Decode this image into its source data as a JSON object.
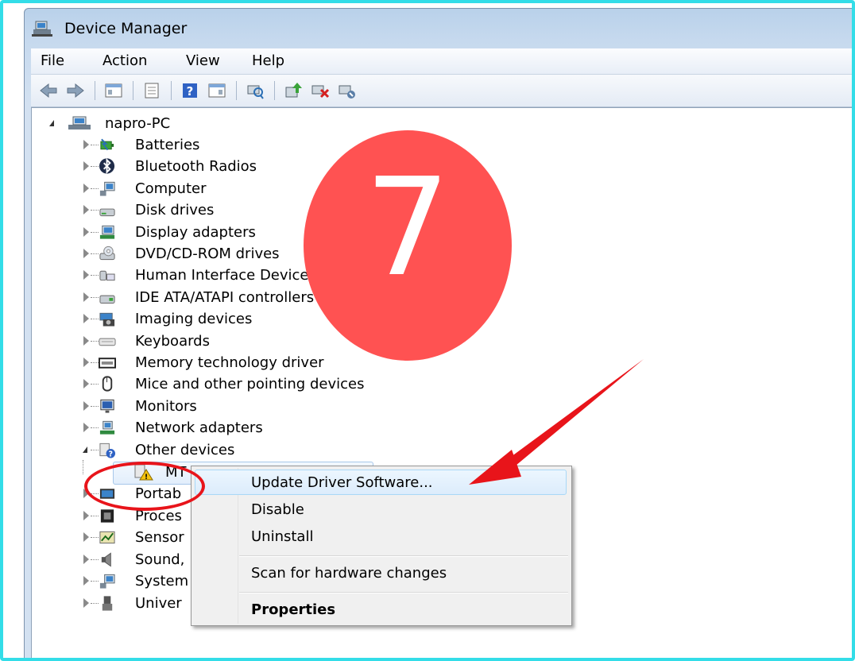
{
  "window": {
    "title": "Device Manager"
  },
  "menu": [
    "File",
    "Action",
    "View",
    "Help"
  ],
  "tree": {
    "root": "napro-PC",
    "items": [
      {
        "label": "Batteries",
        "icon": "battery-icon"
      },
      {
        "label": "Bluetooth Radios",
        "icon": "bluetooth-icon"
      },
      {
        "label": "Computer",
        "icon": "computer-icon"
      },
      {
        "label": "Disk drives",
        "icon": "disk-drive-icon"
      },
      {
        "label": "Display adapters",
        "icon": "display-adapter-icon"
      },
      {
        "label": "DVD/CD-ROM drives",
        "icon": "dvd-drive-icon"
      },
      {
        "label": "Human Interface Devices",
        "icon": "hid-icon"
      },
      {
        "label": "IDE ATA/ATAPI controllers",
        "icon": "ide-controller-icon"
      },
      {
        "label": "Imaging devices",
        "icon": "camera-icon"
      },
      {
        "label": "Keyboards",
        "icon": "keyboard-icon"
      },
      {
        "label": "Memory technology driver",
        "icon": "memory-icon"
      },
      {
        "label": "Mice and other pointing devices",
        "icon": "mouse-icon"
      },
      {
        "label": "Monitors",
        "icon": "monitor-icon"
      },
      {
        "label": "Network adapters",
        "icon": "network-icon"
      },
      {
        "label": "Other devices",
        "icon": "unknown-device-icon"
      }
    ],
    "selected_child": "MT",
    "truncated_items": [
      {
        "label": "Portab",
        "icon": "portable-device-icon"
      },
      {
        "label": "Proces",
        "icon": "processor-icon"
      },
      {
        "label": "Sensor",
        "icon": "sensor-icon"
      },
      {
        "label": "Sound,",
        "icon": "sound-icon"
      },
      {
        "label": "System",
        "icon": "system-icon"
      },
      {
        "label": "Univer",
        "icon": "usb-icon"
      }
    ]
  },
  "context_menu": {
    "update": "Update Driver Software...",
    "disable": "Disable",
    "uninstall": "Uninstall",
    "scan": "Scan for hardware changes",
    "properties": "Properties"
  },
  "overlay": {
    "step_number": "7"
  },
  "colors": {
    "badge": "#ff5252",
    "annotation": "#e8141a",
    "frame": "#33dde8"
  }
}
